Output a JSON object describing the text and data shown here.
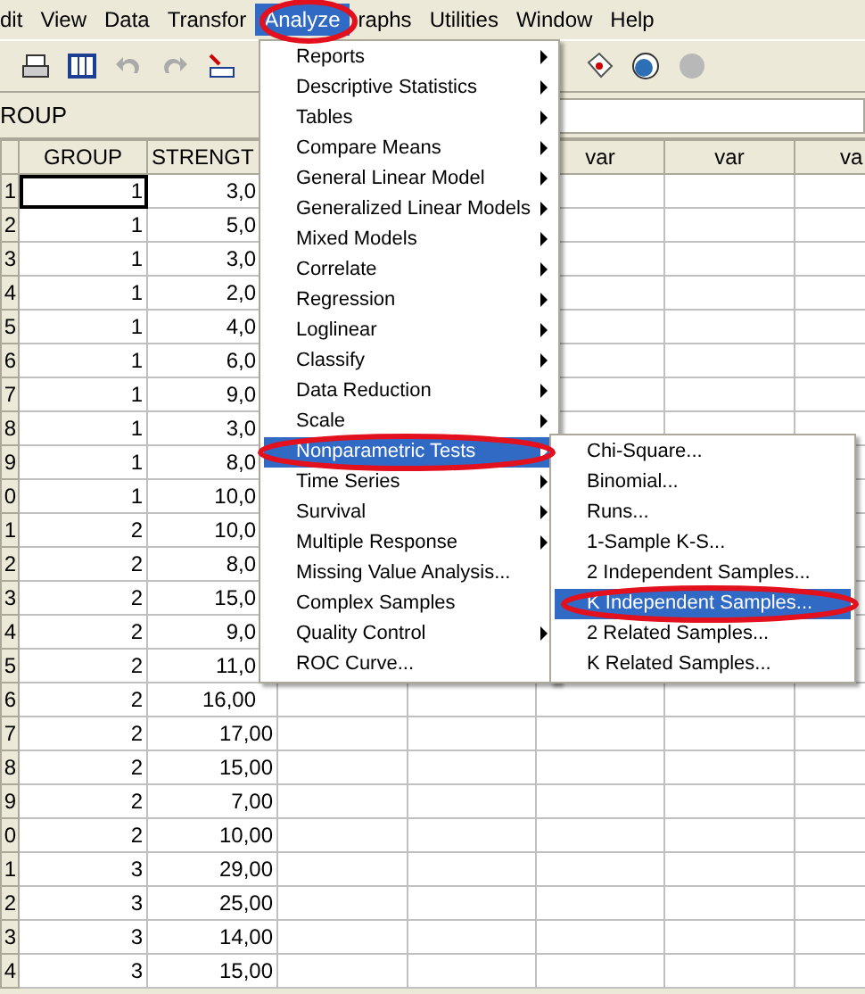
{
  "menubar": [
    {
      "label": "dit",
      "selected": false
    },
    {
      "label": "View",
      "selected": false
    },
    {
      "label": "Data",
      "selected": false
    },
    {
      "label": "Transfor",
      "selected": false
    },
    {
      "label": "Analyze",
      "selected": true
    },
    {
      "label": "raphs",
      "selected": false
    },
    {
      "label": "Utilities",
      "selected": false
    },
    {
      "label": "Window",
      "selected": false
    },
    {
      "label": "Help",
      "selected": false
    }
  ],
  "cell_editor": {
    "variable": "ROUP"
  },
  "table": {
    "columns": [
      "GROUP",
      "STRENGT"
    ],
    "var_columns": [
      "var",
      "var",
      "va"
    ],
    "rows": [
      {
        "row": "1",
        "group": "1",
        "strength": "3,0",
        "selected": true
      },
      {
        "row": "2",
        "group": "1",
        "strength": "5,0",
        "selected": false
      },
      {
        "row": "3",
        "group": "1",
        "strength": "3,0",
        "selected": false
      },
      {
        "row": "4",
        "group": "1",
        "strength": "2,0",
        "selected": false
      },
      {
        "row": "5",
        "group": "1",
        "strength": "4,0",
        "selected": false
      },
      {
        "row": "6",
        "group": "1",
        "strength": "6,0",
        "selected": false
      },
      {
        "row": "7",
        "group": "1",
        "strength": "9,0",
        "selected": false
      },
      {
        "row": "8",
        "group": "1",
        "strength": "3,0",
        "selected": false
      },
      {
        "row": "9",
        "group": "1",
        "strength": "8,0",
        "selected": false
      },
      {
        "row": "0",
        "group": "1",
        "strength": "10,0",
        "selected": false
      },
      {
        "row": "1",
        "group": "2",
        "strength": "10,0",
        "selected": false
      },
      {
        "row": "2",
        "group": "2",
        "strength": "8,0",
        "selected": false
      },
      {
        "row": "3",
        "group": "2",
        "strength": "15,0",
        "selected": false
      },
      {
        "row": "4",
        "group": "2",
        "strength": "9,0",
        "selected": false
      },
      {
        "row": "5",
        "group": "2",
        "strength": "11,0",
        "selected": false
      },
      {
        "row": "6",
        "group": "2",
        "strength": "16,00",
        "selected": false
      },
      {
        "row": "7",
        "group": "2",
        "strength": "17,00",
        "selected": false
      },
      {
        "row": "8",
        "group": "2",
        "strength": "15,00",
        "selected": false
      },
      {
        "row": "9",
        "group": "2",
        "strength": "7,00",
        "selected": false
      },
      {
        "row": "0",
        "group": "2",
        "strength": "10,00",
        "selected": false
      },
      {
        "row": "1",
        "group": "3",
        "strength": "29,00",
        "selected": false
      },
      {
        "row": "2",
        "group": "3",
        "strength": "25,00",
        "selected": false
      },
      {
        "row": "3",
        "group": "3",
        "strength": "14,00",
        "selected": false
      },
      {
        "row": "4",
        "group": "3",
        "strength": "15,00",
        "selected": false
      }
    ]
  },
  "analyze_menu": [
    {
      "label": "Reports",
      "submenu": true,
      "selected": false
    },
    {
      "label": "Descriptive Statistics",
      "submenu": true,
      "selected": false
    },
    {
      "label": "Tables",
      "submenu": true,
      "selected": false
    },
    {
      "label": "Compare Means",
      "submenu": true,
      "selected": false
    },
    {
      "label": "General Linear Model",
      "submenu": true,
      "selected": false
    },
    {
      "label": "Generalized Linear Models",
      "submenu": true,
      "selected": false
    },
    {
      "label": "Mixed Models",
      "submenu": true,
      "selected": false
    },
    {
      "label": "Correlate",
      "submenu": true,
      "selected": false
    },
    {
      "label": "Regression",
      "submenu": true,
      "selected": false
    },
    {
      "label": "Loglinear",
      "submenu": true,
      "selected": false
    },
    {
      "label": "Classify",
      "submenu": true,
      "selected": false
    },
    {
      "label": "Data Reduction",
      "submenu": true,
      "selected": false
    },
    {
      "label": "Scale",
      "submenu": true,
      "selected": false
    },
    {
      "label": "Nonparametric Tests",
      "submenu": true,
      "selected": true
    },
    {
      "label": "Time Series",
      "submenu": true,
      "selected": false
    },
    {
      "label": "Survival",
      "submenu": true,
      "selected": false
    },
    {
      "label": "Multiple Response",
      "submenu": true,
      "selected": false
    },
    {
      "label": "Missing Value Analysis...",
      "submenu": false,
      "selected": false
    },
    {
      "label": "Complex Samples",
      "submenu": false,
      "selected": false
    },
    {
      "label": "Quality Control",
      "submenu": true,
      "selected": false
    },
    {
      "label": "ROC Curve...",
      "submenu": false,
      "selected": false
    }
  ],
  "nonparametric_menu": [
    {
      "label": "Chi-Square...",
      "selected": false
    },
    {
      "label": "Binomial...",
      "selected": false
    },
    {
      "label": "Runs...",
      "selected": false
    },
    {
      "label": "1-Sample K-S...",
      "selected": false
    },
    {
      "label": "2 Independent Samples...",
      "selected": false
    },
    {
      "label": "K Independent Samples...",
      "selected": true
    },
    {
      "label": "2 Related Samples...",
      "selected": false
    },
    {
      "label": "K Related Samples...",
      "selected": false
    }
  ]
}
